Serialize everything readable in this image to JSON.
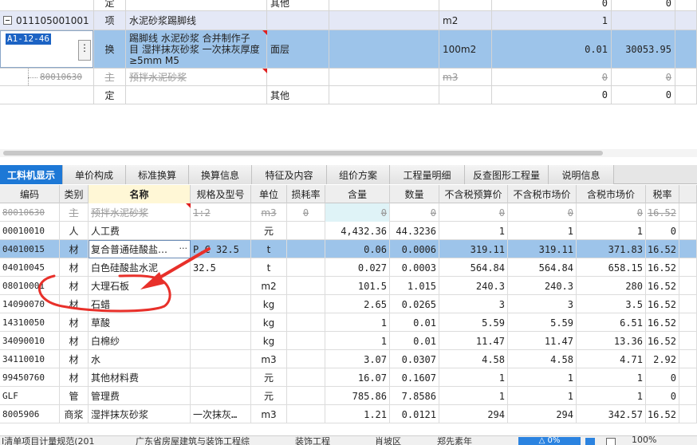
{
  "top_grid": {
    "rows": [
      {
        "code": "",
        "type": "定",
        "name": "",
        "spec": "其他",
        "unit": "",
        "qty": "0",
        "price": "0"
      },
      {
        "code": "011105001001",
        "type": "项",
        "name": "水泥砂浆踢脚线",
        "spec": "",
        "unit": "m2",
        "qty": "1",
        "price": ""
      },
      {
        "code": "A1-12-46",
        "type": "换",
        "name_lines": [
          "踢脚线 水泥砂浆  合并制作子",
          "目 湿拌抹灰砂浆 一次抹灰厚度",
          "≥5mm M5"
        ],
        "spec": "面层",
        "unit": "100m2",
        "qty": "0.01",
        "price": "30053.95"
      },
      {
        "code": "80010630",
        "type": "主",
        "name": "预拌水泥砂浆",
        "spec": "",
        "unit": "m3",
        "qty": "0",
        "price": "0"
      },
      {
        "code": "",
        "type": "定",
        "name": "",
        "spec": "其他",
        "unit": "",
        "qty": "0",
        "price": "0"
      }
    ]
  },
  "tabs": [
    {
      "label": "工料机显示",
      "active": true
    },
    {
      "label": "单价构成"
    },
    {
      "label": "标准换算"
    },
    {
      "label": "换算信息"
    },
    {
      "label": "特征及内容"
    },
    {
      "label": "组价方案"
    },
    {
      "label": "工程量明细"
    },
    {
      "label": "反查图形工程量"
    },
    {
      "label": "说明信息"
    }
  ],
  "bottom_grid": {
    "headers": [
      "编码",
      "类别",
      "名称",
      "规格及型号",
      "单位",
      "损耗率",
      "含量",
      "数量",
      "不含税预算价",
      "不含税市场价",
      "含税市场价",
      "税率"
    ],
    "rows": [
      {
        "code": "80010630",
        "cat": "主",
        "name": "预拌水泥砂浆",
        "spec": "1:2",
        "unit": "m3",
        "loss": "0",
        "content": "0",
        "qty": "0",
        "p1": "0",
        "p2": "0",
        "p3": "0",
        "tax": "16.52"
      },
      {
        "code": "00010010",
        "cat": "人",
        "name": "人工费",
        "spec": "",
        "unit": "元",
        "loss": "",
        "content": "4,432.36",
        "qty": "44.3236",
        "p1": "1",
        "p2": "1",
        "p3": "1",
        "tax": "0"
      },
      {
        "code": "04010015",
        "cat": "材",
        "name": "复合普通硅酸盐…",
        "spec": "P.C 32.5",
        "unit": "t",
        "loss": "",
        "content": "0.06",
        "qty": "0.0006",
        "p1": "319.11",
        "p2": "319.11",
        "p3": "371.83",
        "tax": "16.52"
      },
      {
        "code": "04010045",
        "cat": "材",
        "name": "白色硅酸盐水泥",
        "spec": "32.5",
        "unit": "t",
        "loss": "",
        "content": "0.027",
        "qty": "0.0003",
        "p1": "564.84",
        "p2": "564.84",
        "p3": "658.15",
        "tax": "16.52"
      },
      {
        "code": "08010001",
        "cat": "材",
        "name": "大理石板",
        "spec": "",
        "unit": "m2",
        "loss": "",
        "content": "101.5",
        "qty": "1.015",
        "p1": "240.3",
        "p2": "240.3",
        "p3": "280",
        "tax": "16.52"
      },
      {
        "code": "14090070",
        "cat": "材",
        "name": "石蜡",
        "spec": "",
        "unit": "kg",
        "loss": "",
        "content": "2.65",
        "qty": "0.0265",
        "p1": "3",
        "p2": "3",
        "p3": "3.5",
        "tax": "16.52"
      },
      {
        "code": "14310050",
        "cat": "材",
        "name": "草酸",
        "spec": "",
        "unit": "kg",
        "loss": "",
        "content": "1",
        "qty": "0.01",
        "p1": "5.59",
        "p2": "5.59",
        "p3": "6.51",
        "tax": "16.52"
      },
      {
        "code": "34090010",
        "cat": "材",
        "name": "白棉纱",
        "spec": "",
        "unit": "kg",
        "loss": "",
        "content": "1",
        "qty": "0.01",
        "p1": "11.47",
        "p2": "11.47",
        "p3": "13.36",
        "tax": "16.52"
      },
      {
        "code": "34110010",
        "cat": "材",
        "name": "水",
        "spec": "",
        "unit": "m3",
        "loss": "",
        "content": "3.07",
        "qty": "0.0307",
        "p1": "4.58",
        "p2": "4.58",
        "p3": "4.71",
        "tax": "2.92"
      },
      {
        "code": "99450760",
        "cat": "材",
        "name": "其他材料费",
        "spec": "",
        "unit": "元",
        "loss": "",
        "content": "16.07",
        "qty": "0.1607",
        "p1": "1",
        "p2": "1",
        "p3": "1",
        "tax": "0"
      },
      {
        "code": "GLF",
        "cat": "管",
        "name": "管理费",
        "spec": "",
        "unit": "元",
        "loss": "",
        "content": "785.86",
        "qty": "7.8586",
        "p1": "1",
        "p2": "1",
        "p3": "1",
        "tax": "0"
      },
      {
        "code": "8005906",
        "cat": "商浆",
        "name": "湿拌抹灰砂浆",
        "spec": "一次抹灰…",
        "unit": "m3",
        "loss": "",
        "content": "1.21",
        "qty": "0.0121",
        "p1": "294",
        "p2": "294",
        "p3": "342.57",
        "tax": "16.52"
      }
    ]
  },
  "status_bar": {
    "items": [
      "I清单项目计量规范(201",
      "广东省房屋建筑与装饰工程综",
      "装饰工程",
      "肖坡区",
      "郑先素年",
      "100%"
    ],
    "button": "△ 0%"
  },
  "colors": {
    "accent": "#1d78d6",
    "selected_row": "#9dc4ea",
    "annotation": "#e8302a"
  }
}
